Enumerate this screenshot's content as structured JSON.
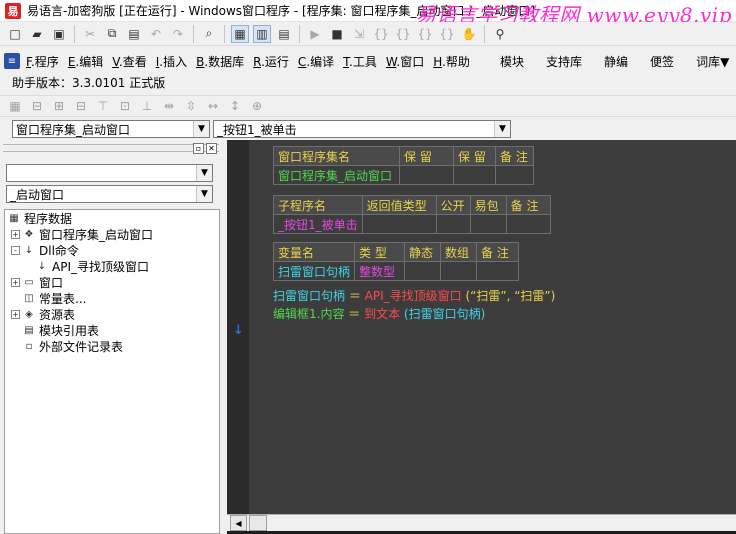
{
  "window": {
    "app_icon_glyph": "易",
    "title": "易语言-加密狗版 [正在运行] - Windows窗口程序 - [程序集: 窗口程序集_启动窗口 / _启动窗口]",
    "watermark": "易语言学习教程网 www.eyy8.vip"
  },
  "toolbar_icons": [
    "new-file-icon",
    "open-folder-icon",
    "save-icon",
    "cut-icon",
    "copy-icon",
    "paste-icon",
    "undo-icon",
    "redo-icon",
    "find-icon",
    "layout-1-icon",
    "layout-2-icon",
    "layout-3-icon",
    "run-icon",
    "stop-icon",
    "step-icon",
    "step-into-icon",
    "step-out-icon",
    "step-over-icon",
    "run-to-cursor-icon",
    "hand-icon",
    "binoculars-icon"
  ],
  "menu": {
    "items": [
      {
        "key": "F",
        "label": ".程序"
      },
      {
        "key": "E",
        "label": ".编辑"
      },
      {
        "key": "V",
        "label": ".查看"
      },
      {
        "key": "I",
        "label": ".插入"
      },
      {
        "key": "B",
        "label": ".数据库"
      },
      {
        "key": "R",
        "label": ".运行"
      },
      {
        "key": "C",
        "label": ".编译"
      },
      {
        "key": "T",
        "label": ".工具"
      },
      {
        "key": "W",
        "label": ".窗口"
      },
      {
        "key": "H",
        "label": ".帮助"
      }
    ],
    "right_items": [
      "模块",
      "支持库",
      "静编",
      "便签",
      "词库▼"
    ]
  },
  "version_label": "助手版本：3.3.0101 正式版",
  "combos": {
    "assembly": "窗口程序集_启动窗口",
    "subroutine": "_按钮1_被单击"
  },
  "left_panel": {
    "combo_top": "",
    "combo_window": "_启动窗口",
    "tree": [
      {
        "label": "程序数据",
        "icon": "program-data-icon",
        "indent": 0,
        "expander": ""
      },
      {
        "label": "窗口程序集_启动窗口",
        "icon": "assembly-icon",
        "indent": 1,
        "expander": "+"
      },
      {
        "label": "Dll命令",
        "icon": "dll-icon",
        "indent": 1,
        "expander": "-"
      },
      {
        "label": "API_寻找顶级窗口",
        "icon": "dll-command-icon",
        "indent": 2,
        "expander": ""
      },
      {
        "label": "窗口",
        "icon": "window-icon",
        "indent": 1,
        "expander": "+"
      },
      {
        "label": "常量表...",
        "icon": "constant-table-icon",
        "indent": 1,
        "expander": ""
      },
      {
        "label": "资源表",
        "icon": "resource-table-icon",
        "indent": 1,
        "expander": "+"
      },
      {
        "label": "模块引用表",
        "icon": "module-ref-icon",
        "indent": 1,
        "expander": ""
      },
      {
        "label": "外部文件记录表",
        "icon": "external-file-icon",
        "indent": 1,
        "expander": ""
      }
    ]
  },
  "editor": {
    "assembly_table": {
      "headers": [
        "窗口程序集名",
        "保 留",
        "保 留",
        "备 注"
      ],
      "values": [
        "窗口程序集_启动窗口",
        "",
        "",
        ""
      ]
    },
    "sub_table": {
      "headers": [
        "子程序名",
        "返回值类型",
        "公开",
        "易包",
        "备 注"
      ],
      "values": [
        "_按钮1_被单击",
        "",
        "",
        "",
        ""
      ]
    },
    "var_table": {
      "headers": [
        "变量名",
        "类 型",
        "静态",
        "数组",
        "备 注"
      ],
      "values": [
        "扫雷窗口句柄",
        "整数型",
        "",
        "",
        ""
      ]
    },
    "code_lines": [
      {
        "target": "扫雷窗口句柄",
        "op": " ＝ ",
        "call": "API_寻找顶级窗口",
        "args": " (“扫雷”, “扫雷”)"
      },
      {
        "target": "编辑框1.内容",
        "op": " ＝ ",
        "call": "到文本",
        "args": " (扫雷窗口句柄)"
      }
    ],
    "gutter_marker": "↓"
  },
  "colors": {
    "watermark": "#ff2ad0",
    "header_text": "#e8d44d",
    "name_green": "#4fd84f",
    "type_magenta": "#e24ae2",
    "code_cyan": "#3fd3e8"
  }
}
